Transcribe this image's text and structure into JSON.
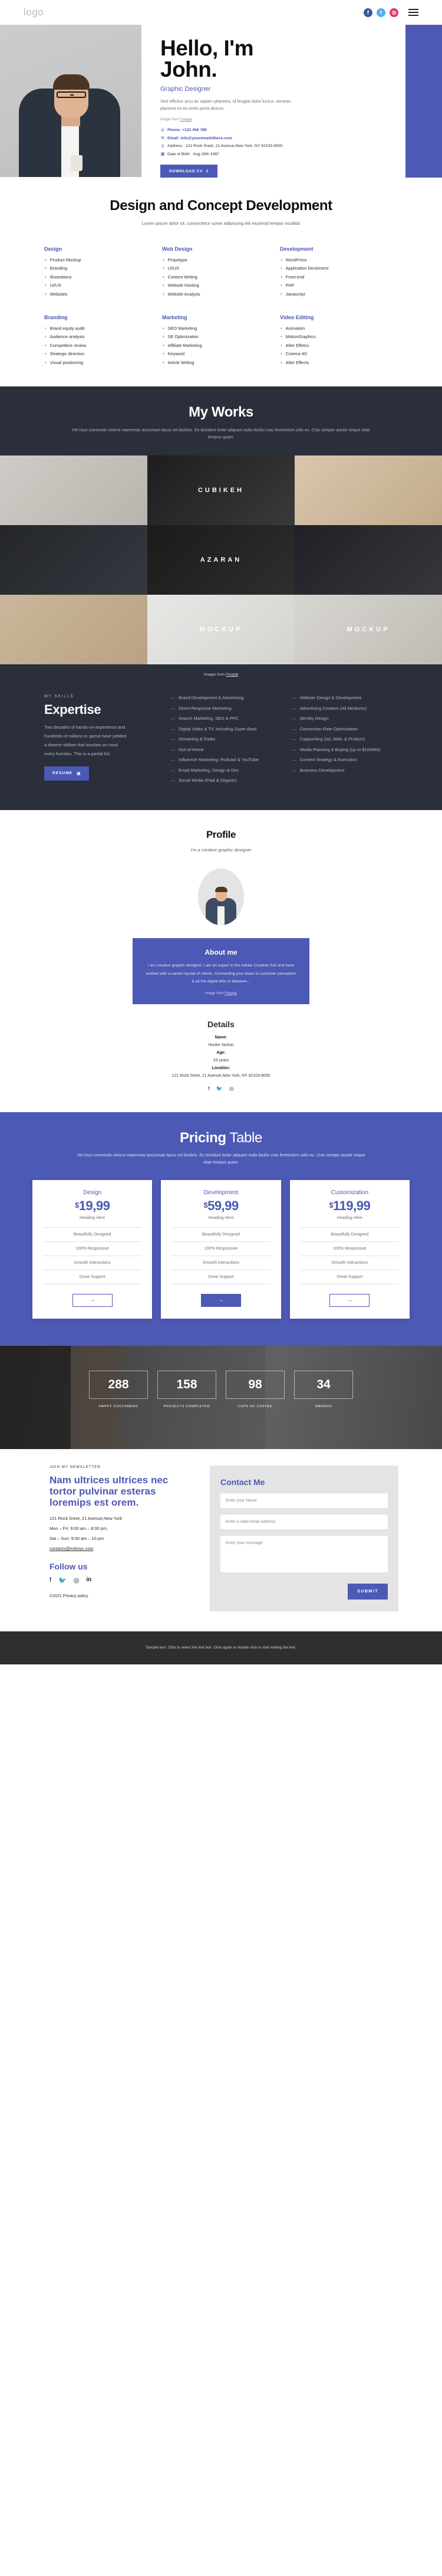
{
  "header": {
    "logo": "logo",
    "social": [
      {
        "name": "facebook-icon",
        "glyph": "f"
      },
      {
        "name": "twitter-icon",
        "glyph": "t"
      },
      {
        "name": "instagram-icon",
        "glyph": "◉"
      }
    ]
  },
  "hero": {
    "title_line1": "Hello, I'm",
    "title_line2": "John.",
    "subtitle": "Graphic Designer",
    "description": "Sed efficitur arcu ac sapien pharetra, id feugiat dolor luctus. Aenean placerat mi eu enim porta dictum.",
    "credit_prefix": "Image from ",
    "credit_link": "Freepik",
    "contacts": [
      {
        "icon": "phone-icon",
        "glyph": "✆",
        "label": "Phone: ",
        "value": "+123 456 789"
      },
      {
        "icon": "email-icon",
        "glyph": "✉",
        "label": "Email: ",
        "value": "info@youremailidhere.com"
      },
      {
        "icon": "location-icon",
        "glyph": "⚲",
        "label": "Address: ",
        "value": "121 Rock Sreet, 21 Avenue,New York, NY 92103-9000"
      },
      {
        "icon": "calendar-icon",
        "glyph": "▦",
        "label": "Date of Birth: ",
        "value": "Aug 28th 1987"
      }
    ],
    "cta_label": "DOWNLOAD CV",
    "cta_icon": "download-icon"
  },
  "services": {
    "title": "Design and Concept Development",
    "subtitle": "Lorem ipsum dolor sit, consectetur some adipiscing elit eiusmod tempor incididu",
    "columns": [
      {
        "heading": "Design",
        "items": [
          "Product Mockup",
          "Branding",
          "Illustrations",
          "UI/UX",
          "Websites"
        ]
      },
      {
        "heading": "Web Design",
        "items": [
          "Propotype",
          "UI/UX",
          "Content Writing",
          "Website Hosting",
          "Website Analysis"
        ]
      },
      {
        "heading": "Development",
        "items": [
          "WordPress",
          "Application Devloment",
          "Front-end",
          "PHP",
          "Javascript"
        ]
      },
      {
        "heading": "Branding",
        "items": [
          "Brand equity audit",
          "Audience analysis",
          "Competitive review",
          "Strategic direction",
          "Visual positioning"
        ]
      },
      {
        "heading": "Marketing",
        "items": [
          "SEO Marketing",
          "SE Optimization",
          "Affiliate Marketing",
          "Keyword",
          "Article Writing"
        ]
      },
      {
        "heading": "Video Editing",
        "items": [
          "Animation",
          "MotionGraphics",
          "After Effetcs",
          "Cinema 4D",
          "After Effects"
        ]
      }
    ]
  },
  "works": {
    "title": "My Works",
    "subtitle": "Vel risus commodo viverra maecenas accumsan lacus vel facilisis. Eu tincidunt tortor aliquam nulla facilisi cras fermentum odio eu. Cras semper auctor neque vitae tempus quam.",
    "credit_prefix": "Images from ",
    "credit_link": "Freepik",
    "tiles": [
      {
        "name": "tile-logo-triangle",
        "label": "",
        "c1": "#cfcbc6",
        "c2": "#b9b4ad"
      },
      {
        "name": "tile-cubikeh",
        "label": "CUBIKEH",
        "c1": "#1d1d1d",
        "c2": "#3a3a3a"
      },
      {
        "name": "tile-leather-card",
        "label": "",
        "c1": "#d9c6ad",
        "c2": "#c2ab8c"
      },
      {
        "name": "tile-dark-cards",
        "label": "",
        "c1": "#24262b",
        "c2": "#35383f"
      },
      {
        "name": "tile-azaran",
        "label": "AZARAN",
        "c1": "#1b1b1b",
        "c2": "#2e2e2e"
      },
      {
        "name": "tile-lion-badge",
        "label": "",
        "c1": "#1f2126",
        "c2": "#35373d"
      },
      {
        "name": "tile-card-stack",
        "label": "",
        "c1": "#cbb79b",
        "c2": "#b9a184"
      },
      {
        "name": "tile-mockup-pen",
        "label": "MOCKUP",
        "c1": "#e7e7e5",
        "c2": "#d3d3d0"
      },
      {
        "name": "tile-mockup-vertical",
        "label": "MOCKUP",
        "c1": "#d8d6d1",
        "c2": "#bfbcb5"
      }
    ]
  },
  "expertise": {
    "kicker": "MY SKILLS",
    "title": "Expertise",
    "body": "Two decades of hands-on experience and hundreds of millions in spend have yielded a diverse skillset that touches on most every function. This is a partial list.",
    "button_label": "RESUME",
    "button_icon": "document-icon",
    "col2": [
      "Brand Development & Advertising",
      "Direct-Response Marketing",
      "Search Marketing: SEO & PPC",
      "Digital Video & TV, including Super Bowl",
      "Streaming & Radio",
      "Out-of-Home",
      "Influencer Marketing: Podcast & YouTube",
      "Email Marketing, Design & Dev",
      "Social Media (Paid & Organic)"
    ],
    "col3": [
      "Website Design & Development",
      "Advertising Creative (All Mediums)",
      "Identity Design",
      "Conversion Rate Optimization",
      "Copywriting (Ad, Web, & Product)",
      "Media Planning & Buying (up to $100MM)",
      "Content Strategy & Execution",
      "Business Development"
    ]
  },
  "profile": {
    "title": "Profile",
    "subtitle": "I'm a creative graphic designer",
    "about_title": "About me",
    "about_body": "I am creative graphic designer. I am an expert in the Adobe Creative Suit and have worked with a varied myriad of clients. Connecting your ideas to customer perception & all the digital dots in between...",
    "credit_prefix": "Image from ",
    "credit_link": "Freepik",
    "details_title": "Details",
    "details": [
      {
        "key": "Name:",
        "value": "Hunter Norton"
      },
      {
        "key": "Age:",
        "value": "33 years"
      },
      {
        "key": "Location:",
        "value": "121 Rock Sreet, 21 Avenue,New York, NY 92103-9000"
      }
    ],
    "social": [
      {
        "name": "facebook-icon",
        "glyph": "f"
      },
      {
        "name": "twitter-icon",
        "glyph": "🐦"
      },
      {
        "name": "instagram-icon",
        "glyph": "◉"
      }
    ]
  },
  "pricing": {
    "title_bold": "Pricing",
    "title_thin": " Table",
    "subtitle": "Vel risus commodo viverra maecenas accumsan lacus vel facilisis. Eu tincidunt tortor aliquam nulla facilisi cras fermentum odio eu. Cras semper auctor neque vitae tempus quam.",
    "features": [
      "Beautifully Designed",
      "100% Responsive",
      "Smooth Interactions",
      "Great Support"
    ],
    "plans": [
      {
        "name": "Design",
        "price": "19,99",
        "currency": "$",
        "heading": "Heading Here",
        "featured": false,
        "button_icon": "arrow-right-icon"
      },
      {
        "name": "Development",
        "price": "59,99",
        "currency": "$",
        "heading": "Heading Here",
        "featured": true,
        "button_icon": "arrow-right-icon"
      },
      {
        "name": "Customization",
        "price": "119,99",
        "currency": "$",
        "heading": "Heading Here",
        "featured": false,
        "button_icon": "arrow-right-icon"
      }
    ]
  },
  "counters": [
    {
      "value": "288",
      "label": "HAPPY CUSTOMERS"
    },
    {
      "value": "158",
      "label": "PROJECTS COMPLETED"
    },
    {
      "value": "98",
      "label": "CUPS OF COFFEE"
    },
    {
      "value": "34",
      "label": "AWARDS"
    }
  ],
  "contact": {
    "kicker": "JOIN MY NEWSLETTER",
    "headline": "Nam ultrices ultrices nec tortor pulvinar esteras loremips est orem.",
    "address": "121 Rock Sreet, 21 Avenue,New York",
    "hours_weekday": "Mon – Fri: 9:00 am – 8:00 pm,",
    "hours_weekend": "Sat – Sun: 9:00 am – 10 pm",
    "email": "contacts@esbnyc.com",
    "follow_title": "Follow us",
    "social": [
      {
        "name": "facebook-icon",
        "glyph": "f"
      },
      {
        "name": "twitter-icon",
        "glyph": "🐦"
      },
      {
        "name": "instagram-icon",
        "glyph": "◉"
      },
      {
        "name": "linkedin-icon",
        "glyph": "in"
      }
    ],
    "copyright": "©2021 Privacy policy",
    "form_title": "Contact Me",
    "name_placeholder": "Enter your Name",
    "email_placeholder": "Enter a valid email address",
    "message_placeholder": "Enter your message",
    "submit_label": "SUBMIT"
  },
  "footer": {
    "text": "Sample text. Click to select the text box. Click again or double click to start editing the text."
  },
  "colors": {
    "accent": "#4c59b5",
    "dark": "#2b2e3b",
    "footer": "#2f2f2f"
  }
}
